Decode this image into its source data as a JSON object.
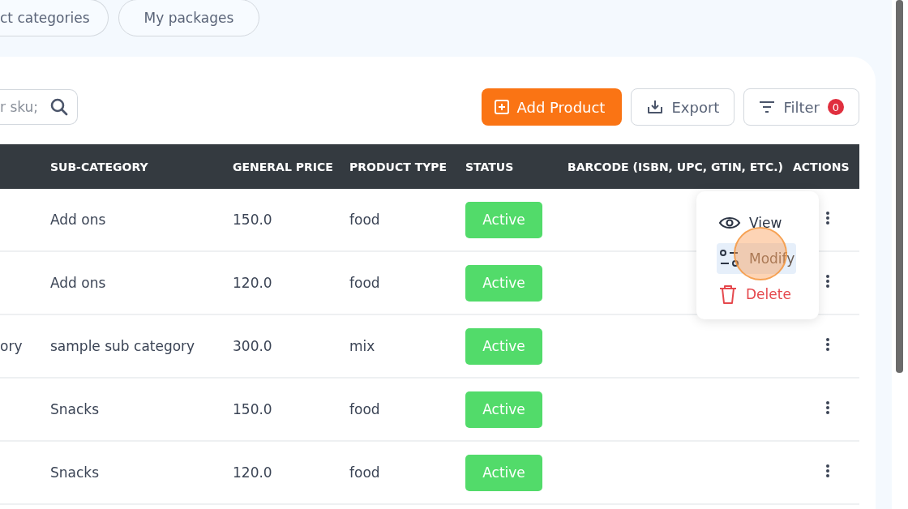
{
  "tabs": [
    {
      "label": "ct categories",
      "selected": false
    },
    {
      "label": "My packages",
      "selected": false
    }
  ],
  "search": {
    "placeholder": "r sku;"
  },
  "toolbar": {
    "add_button": "Add Product",
    "export_button": "Export",
    "filter_button": "Filter",
    "filter_count": "0"
  },
  "table": {
    "columns": [
      "SUB-CATEGORY",
      "GENERAL PRICE",
      "PRODUCT TYPE",
      "STATUS",
      "BARCODE (ISBN, UPC, GTIN, ETC.)",
      "ACTIONS"
    ],
    "rows": [
      {
        "sub_category": "Add ons",
        "price": "150.0",
        "product_type": "food",
        "status": "Active"
      },
      {
        "sub_category": "Add ons",
        "price": "120.0",
        "product_type": "food",
        "status": "Active"
      },
      {
        "column_1": "ory",
        "sub_category": "sample sub category",
        "price": "300.0",
        "product_type": "mix",
        "status": "Active"
      },
      {
        "sub_category": "Snacks",
        "price": "150.0",
        "product_type": "food",
        "status": "Active"
      },
      {
        "sub_category": "Snacks",
        "price": "120.0",
        "product_type": "food",
        "status": "Active"
      }
    ]
  },
  "action_menu": {
    "items": [
      {
        "kind": "view",
        "label": "View",
        "selected": false
      },
      {
        "kind": "modify",
        "label": "Modify",
        "selected": true
      },
      {
        "kind": "delete",
        "label": "Delete",
        "selected": false
      }
    ]
  }
}
